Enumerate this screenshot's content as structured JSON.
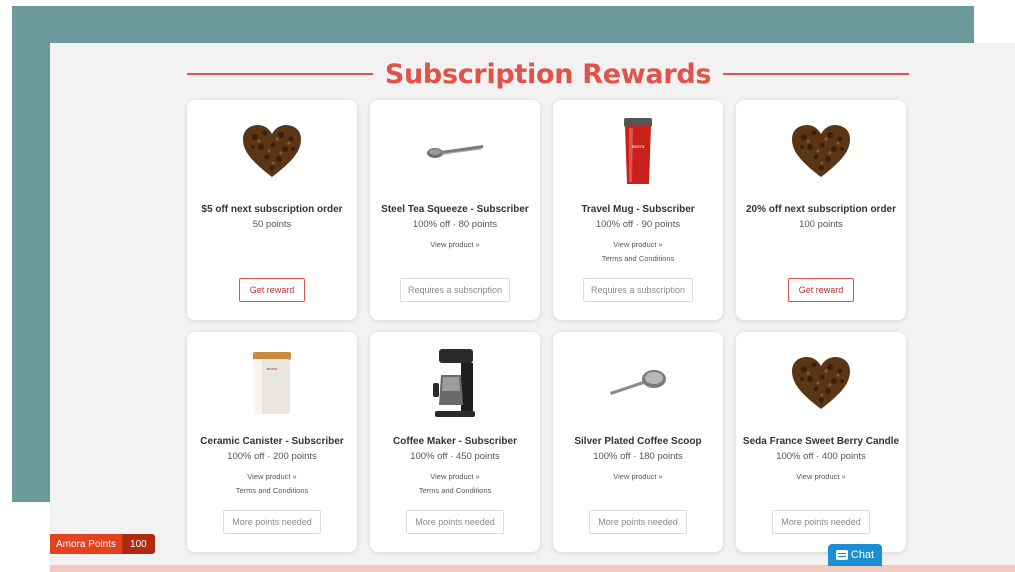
{
  "header": {
    "title": "Subscription Rewards"
  },
  "colors": {
    "accent": "#e0524a",
    "teal_background": "#6b9a9d",
    "points_badge": "#e2421f",
    "chat": "#1b8fd1"
  },
  "rewards": [
    {
      "title": "$5 off next subscription order",
      "subtitle": "50 points",
      "links": [],
      "button": "Get reward",
      "button_state": "available",
      "icon": "coffee-bean-heart-icon"
    },
    {
      "title": "Steel Tea Squeeze - Subscriber",
      "subtitle": "100% off · 80 points",
      "links": [
        "View product »"
      ],
      "button": "Requires a subscription",
      "button_state": "disabled",
      "icon": "tea-squeeze-icon"
    },
    {
      "title": "Travel Mug - Subscriber",
      "subtitle": "100% off · 90 points",
      "links": [
        "View product »",
        "Terms and Conditions"
      ],
      "button": "Requires a subscription",
      "button_state": "disabled",
      "icon": "travel-mug-icon"
    },
    {
      "title": "20% off next subscription order",
      "subtitle": "100 points",
      "links": [],
      "button": "Get reward",
      "button_state": "available",
      "icon": "coffee-bean-heart-icon"
    },
    {
      "title": "Ceramic Canister - Subscriber",
      "subtitle": "100% off · 200 points",
      "links": [
        "View product »",
        "Terms and Conditions"
      ],
      "button": "More points needed",
      "button_state": "disabled",
      "icon": "ceramic-canister-icon"
    },
    {
      "title": "Coffee Maker - Subscriber",
      "subtitle": "100% off · 450 points",
      "links": [
        "View product »",
        "Terms and Conditions"
      ],
      "button": "More points needed",
      "button_state": "disabled",
      "icon": "coffee-maker-icon"
    },
    {
      "title": "Silver Plated Coffee Scoop",
      "subtitle": "100% off · 180 points",
      "links": [
        "View product »"
      ],
      "button": "More points needed",
      "button_state": "disabled",
      "icon": "coffee-scoop-icon"
    },
    {
      "title": "Seda France Sweet Berry Candle",
      "subtitle": "100% off · 400 points",
      "links": [
        "View product »"
      ],
      "button": "More points needed",
      "button_state": "disabled",
      "icon": "coffee-bean-heart-icon"
    }
  ],
  "points_widget": {
    "label": "Amora Points",
    "count": "100"
  },
  "chat": {
    "label": "Chat"
  }
}
